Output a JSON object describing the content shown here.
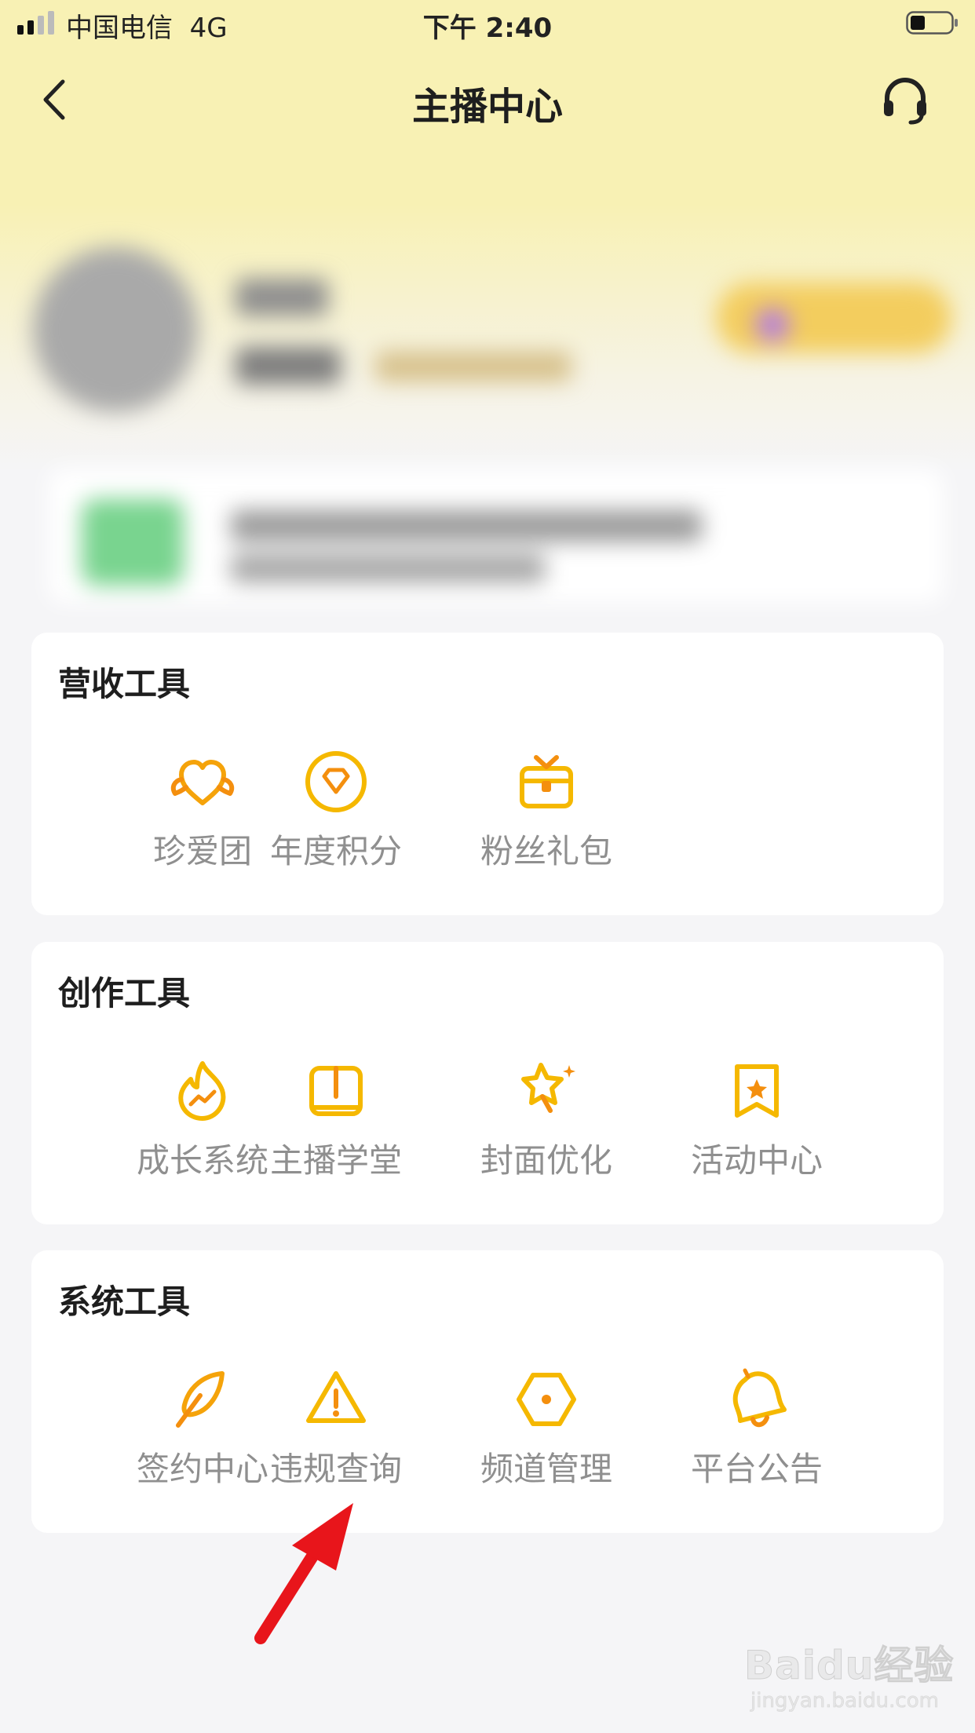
{
  "status_bar": {
    "carrier": "中国电信",
    "network": "4G",
    "time": "下午 2:40"
  },
  "nav": {
    "title": "主播中心",
    "back_icon": "chevron-left-icon",
    "service_icon": "headset-icon"
  },
  "sections": [
    {
      "title": "营收工具",
      "tools": [
        {
          "label": "珍爱团",
          "icon": "heart-wings-icon"
        },
        {
          "label": "年度积分",
          "icon": "diamond-badge-icon"
        },
        {
          "label": "粉丝礼包",
          "icon": "gift-box-icon"
        }
      ]
    },
    {
      "title": "创作工具",
      "tools": [
        {
          "label": "成长系统",
          "icon": "flame-trend-icon"
        },
        {
          "label": "主播学堂",
          "icon": "book-icon"
        },
        {
          "label": "封面优化",
          "icon": "magic-star-icon"
        },
        {
          "label": "活动中心",
          "icon": "bookmark-star-icon"
        }
      ]
    },
    {
      "title": "系统工具",
      "tools": [
        {
          "label": "签约中心",
          "icon": "feather-pen-icon"
        },
        {
          "label": "违规查询",
          "icon": "warning-triangle-icon"
        },
        {
          "label": "频道管理",
          "icon": "hexagon-icon"
        },
        {
          "label": "平台公告",
          "icon": "bell-icon"
        }
      ]
    }
  ],
  "watermark": {
    "logo": "Baidu经验",
    "url": "jingyan.baidu.com"
  },
  "colors": {
    "accent": "#F7B500",
    "accent_deep": "#F48F0E",
    "header_bg": "#F8F1B4",
    "annotation_arrow": "#E8151B"
  }
}
